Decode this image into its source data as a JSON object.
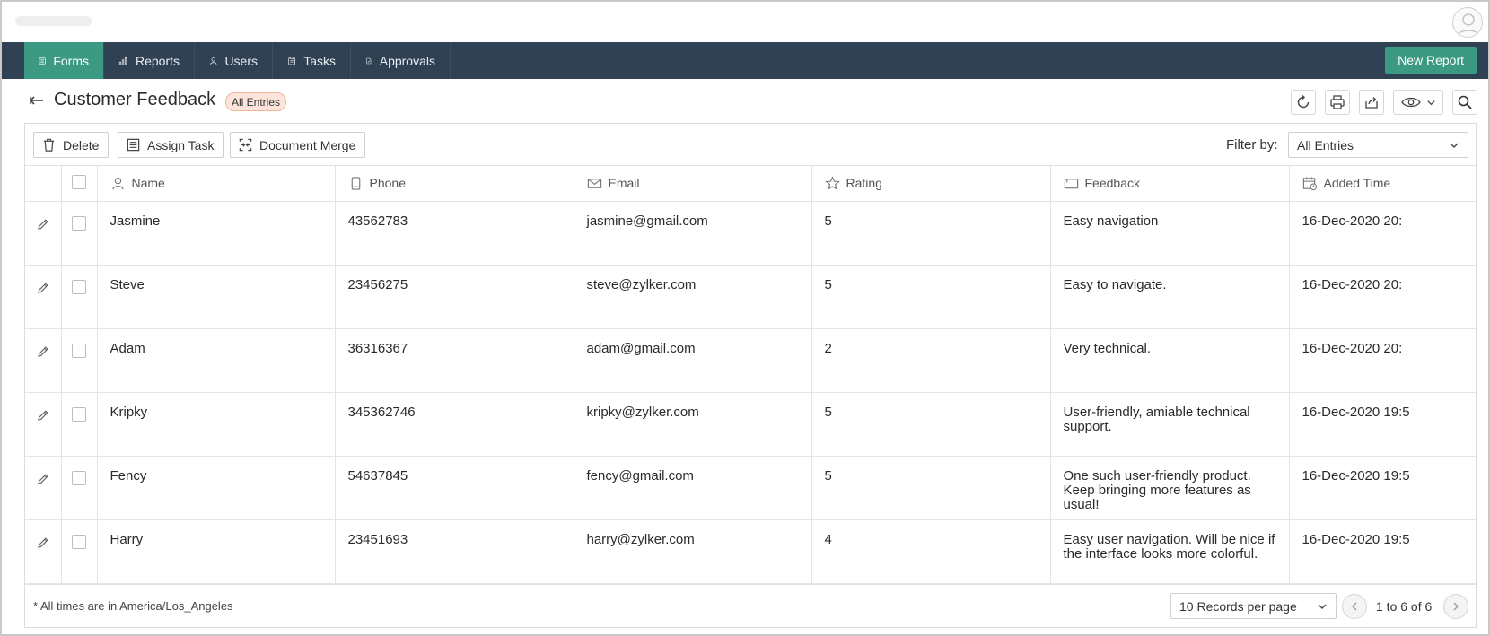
{
  "nav": {
    "items": [
      {
        "label": "Forms",
        "icon": "forms-icon",
        "active": true
      },
      {
        "label": "Reports",
        "icon": "reports-icon",
        "active": false
      },
      {
        "label": "Users",
        "icon": "user-icon",
        "active": false
      },
      {
        "label": "Tasks",
        "icon": "tasks-icon",
        "active": false
      },
      {
        "label": "Approvals",
        "icon": "approvals-icon",
        "active": false
      }
    ],
    "new_report_label": "New Report"
  },
  "header": {
    "title": "Customer Feedback",
    "badge": "All Entries"
  },
  "actions": {
    "delete_label": "Delete",
    "assign_task_label": "Assign Task",
    "document_merge_label": "Document Merge",
    "filter_label": "Filter by:",
    "filter_value": "All Entries"
  },
  "table": {
    "columns": [
      "Name",
      "Phone",
      "Email",
      "Rating",
      "Feedback",
      "Added Time"
    ],
    "rows": [
      {
        "name": "Jasmine",
        "phone": "43562783",
        "email": "jasmine@gmail.com",
        "rating": "5",
        "feedback": "Easy navigation",
        "added": "16-Dec-2020 20:"
      },
      {
        "name": "Steve",
        "phone": "23456275",
        "email": "steve@zylker.com",
        "rating": "5",
        "feedback": "Easy to navigate.",
        "added": "16-Dec-2020 20:"
      },
      {
        "name": "Adam",
        "phone": "36316367",
        "email": "adam@gmail.com",
        "rating": "2",
        "feedback": "Very technical.",
        "added": "16-Dec-2020 20:"
      },
      {
        "name": "Kripky",
        "phone": "345362746",
        "email": "kripky@zylker.com",
        "rating": "5",
        "feedback": "User-friendly, amiable technical support.",
        "added": "16-Dec-2020 19:5"
      },
      {
        "name": "Fency",
        "phone": "54637845",
        "email": "fency@gmail.com",
        "rating": "5",
        "feedback": "One such user-friendly product. Keep bringing more features as usual!",
        "added": "16-Dec-2020 19:5"
      },
      {
        "name": "Harry",
        "phone": "23451693",
        "email": "harry@zylker.com",
        "rating": "4",
        "feedback": "Easy user navigation. Will be nice if the interface looks more colorful.",
        "added": "16-Dec-2020 19:5"
      }
    ]
  },
  "footer": {
    "timezone_note": "* All times are in America/Los_Angeles",
    "per_page": "10 Records per page",
    "pagination": "1 to 6 of 6"
  },
  "colors": {
    "nav_bg": "#2f4152",
    "accent": "#3c9a82",
    "badge_bg": "#fde4da"
  }
}
